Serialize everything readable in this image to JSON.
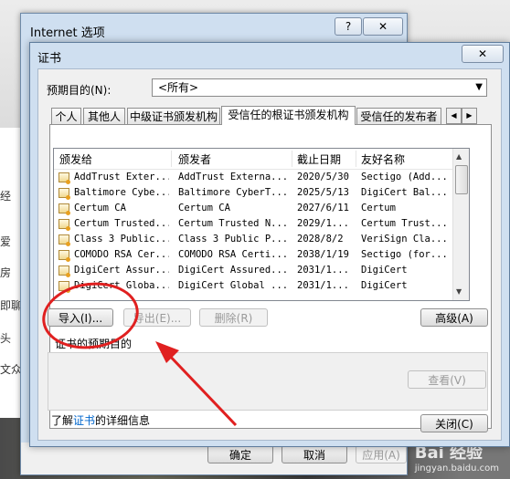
{
  "outer_window": {
    "title": "Internet 选项",
    "help_btn": "?",
    "close_btn": "✕",
    "ok": "确定",
    "cancel": "取消",
    "apply": "应用(A)"
  },
  "background_fragments": [
    "经",
    "爱",
    "房",
    "即聊",
    "头",
    "文众"
  ],
  "dialog": {
    "title": "证书",
    "close_btn": "✕",
    "purpose_label": "预期目的(N):",
    "purpose_value": "<所有>",
    "tabs": [
      "个人",
      "其他人",
      "中级证书颁发机构",
      "受信任的根证书颁发机构",
      "受信任的发布者"
    ],
    "active_tab": 3,
    "columns": [
      "颁发给",
      "颁发者",
      "截止日期",
      "友好名称"
    ],
    "rows": [
      [
        "AddTrust Exter...",
        "AddTrust Externa...",
        "2020/5/30",
        "Sectigo (Add..."
      ],
      [
        "Baltimore Cybe...",
        "Baltimore CyberT...",
        "2025/5/13",
        "DigiCert Bal..."
      ],
      [
        "Certum CA",
        "Certum CA",
        "2027/6/11",
        "Certum"
      ],
      [
        "Certum Trusted...",
        "Certum Trusted N...",
        "2029/1...",
        "Certum Trust..."
      ],
      [
        "Class 3 Public...",
        "Class 3 Public P...",
        "2028/8/2",
        "VeriSign Cla..."
      ],
      [
        "COMODO RSA Cer...",
        "COMODO RSA Certi...",
        "2038/1/19",
        "Sectigo (for..."
      ],
      [
        "DigiCert Assur...",
        "DigiCert Assured...",
        "2031/1...",
        "DigiCert"
      ],
      [
        "DigiCert Globa...",
        "DigiCert Global ...",
        "2031/1...",
        "DigiCert"
      ]
    ],
    "import_btn": "导入(I)...",
    "export_btn": "导出(E)...",
    "remove_btn": "删除(R)",
    "advanced_btn": "高级(A)",
    "purpose_group_label": "证书的预期目的",
    "view_btn": "查看(V)",
    "learn_prefix": "了解",
    "learn_link": "证书",
    "learn_suffix": "的详细信息",
    "close_button": "关闭(C)"
  },
  "watermark": {
    "main": "Bai 经验",
    "sub": "jingyan.baidu.com"
  },
  "colors": {
    "annotation": "#e02020",
    "link": "#0066cc",
    "titlebar": "#cfdff0"
  }
}
